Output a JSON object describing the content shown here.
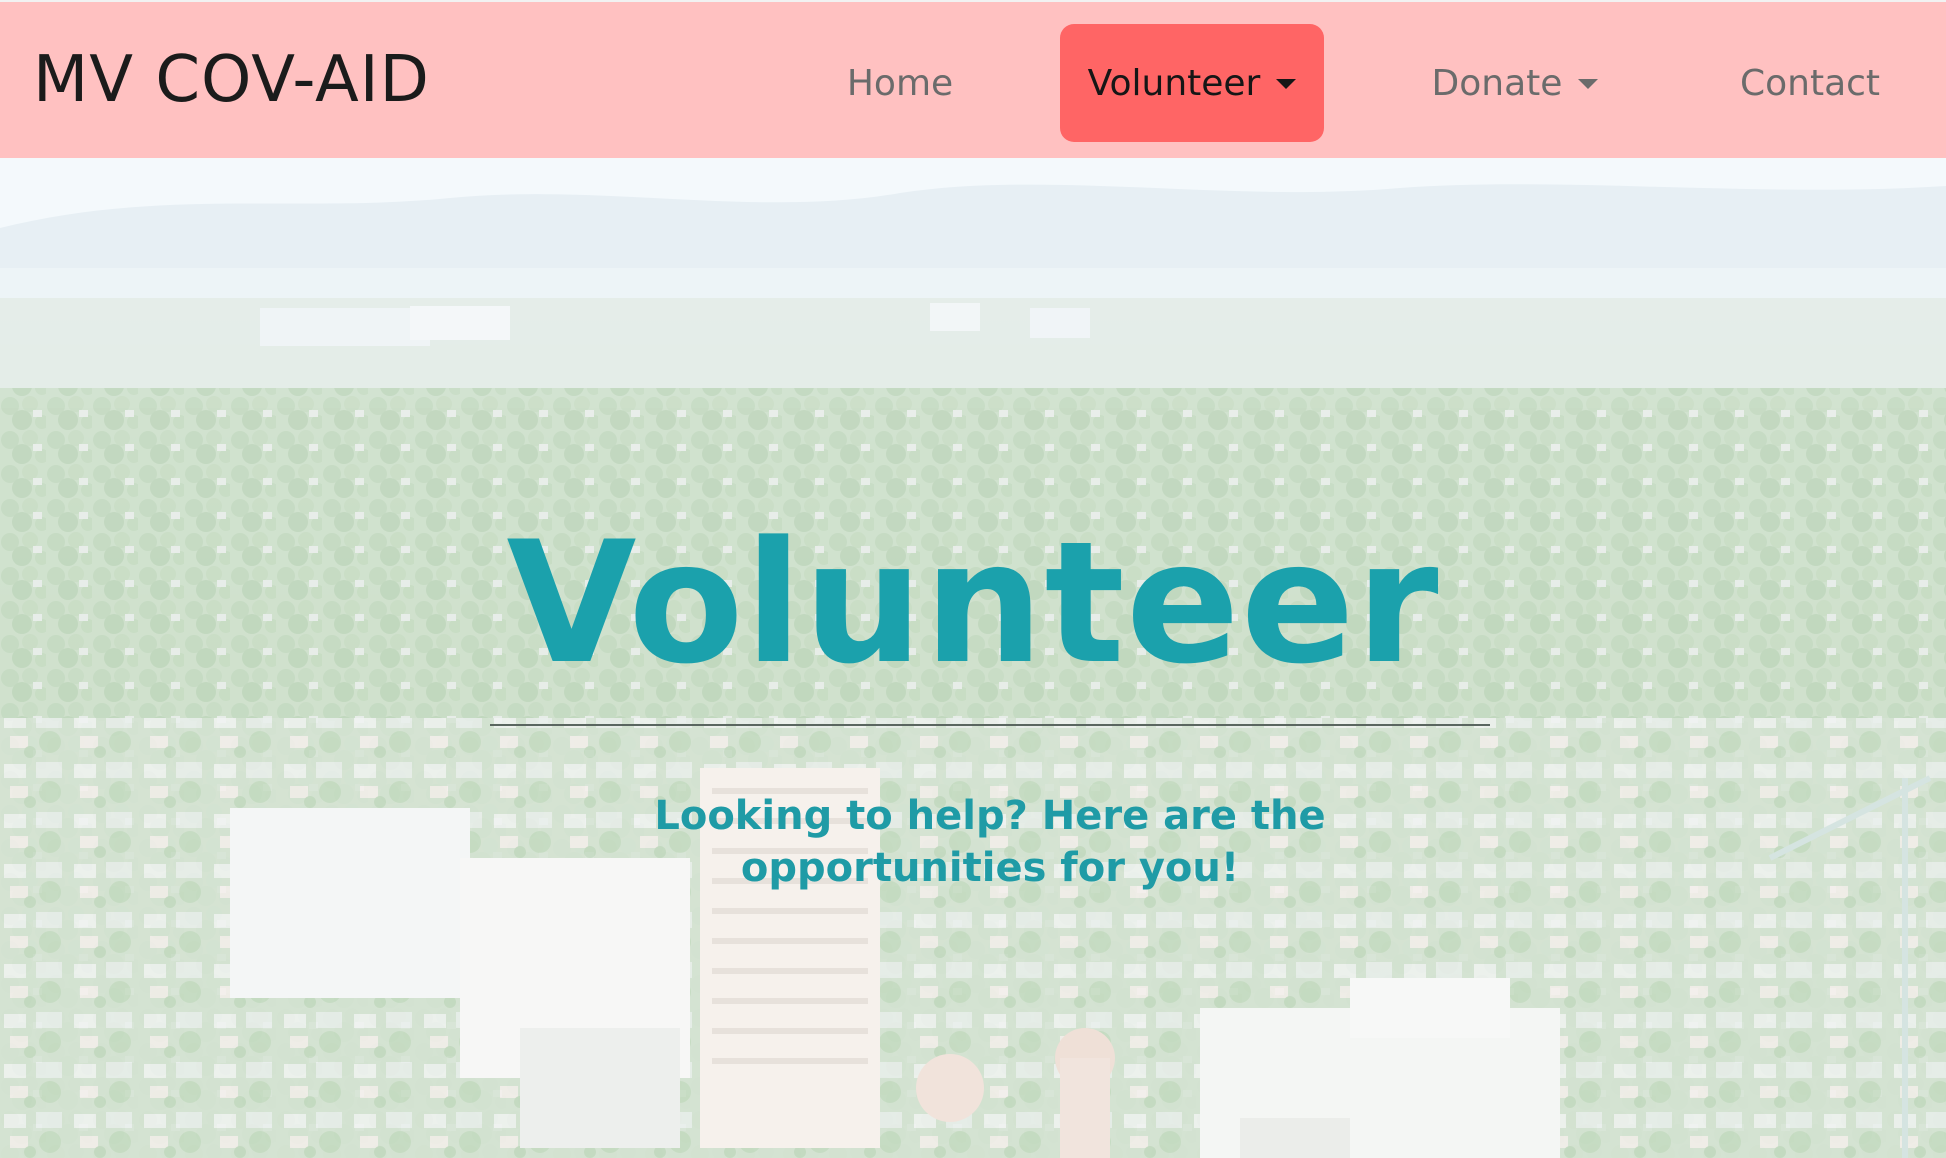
{
  "navbar": {
    "brand": "MV COV-AID",
    "items": [
      {
        "label": "Home",
        "active": false,
        "dropdown": false
      },
      {
        "label": "Volunteer",
        "active": true,
        "dropdown": true
      },
      {
        "label": "Donate",
        "active": false,
        "dropdown": true
      },
      {
        "label": "Contact",
        "active": false,
        "dropdown": false
      }
    ],
    "colors": {
      "background": "#ffc1c1",
      "active_background": "#ff6565"
    }
  },
  "hero": {
    "title": "Volunteer",
    "subtitle": "Looking to help? Here are the opportunities for you!",
    "title_color": "#1ba1ac",
    "background_image": "aerial-city-photo"
  }
}
